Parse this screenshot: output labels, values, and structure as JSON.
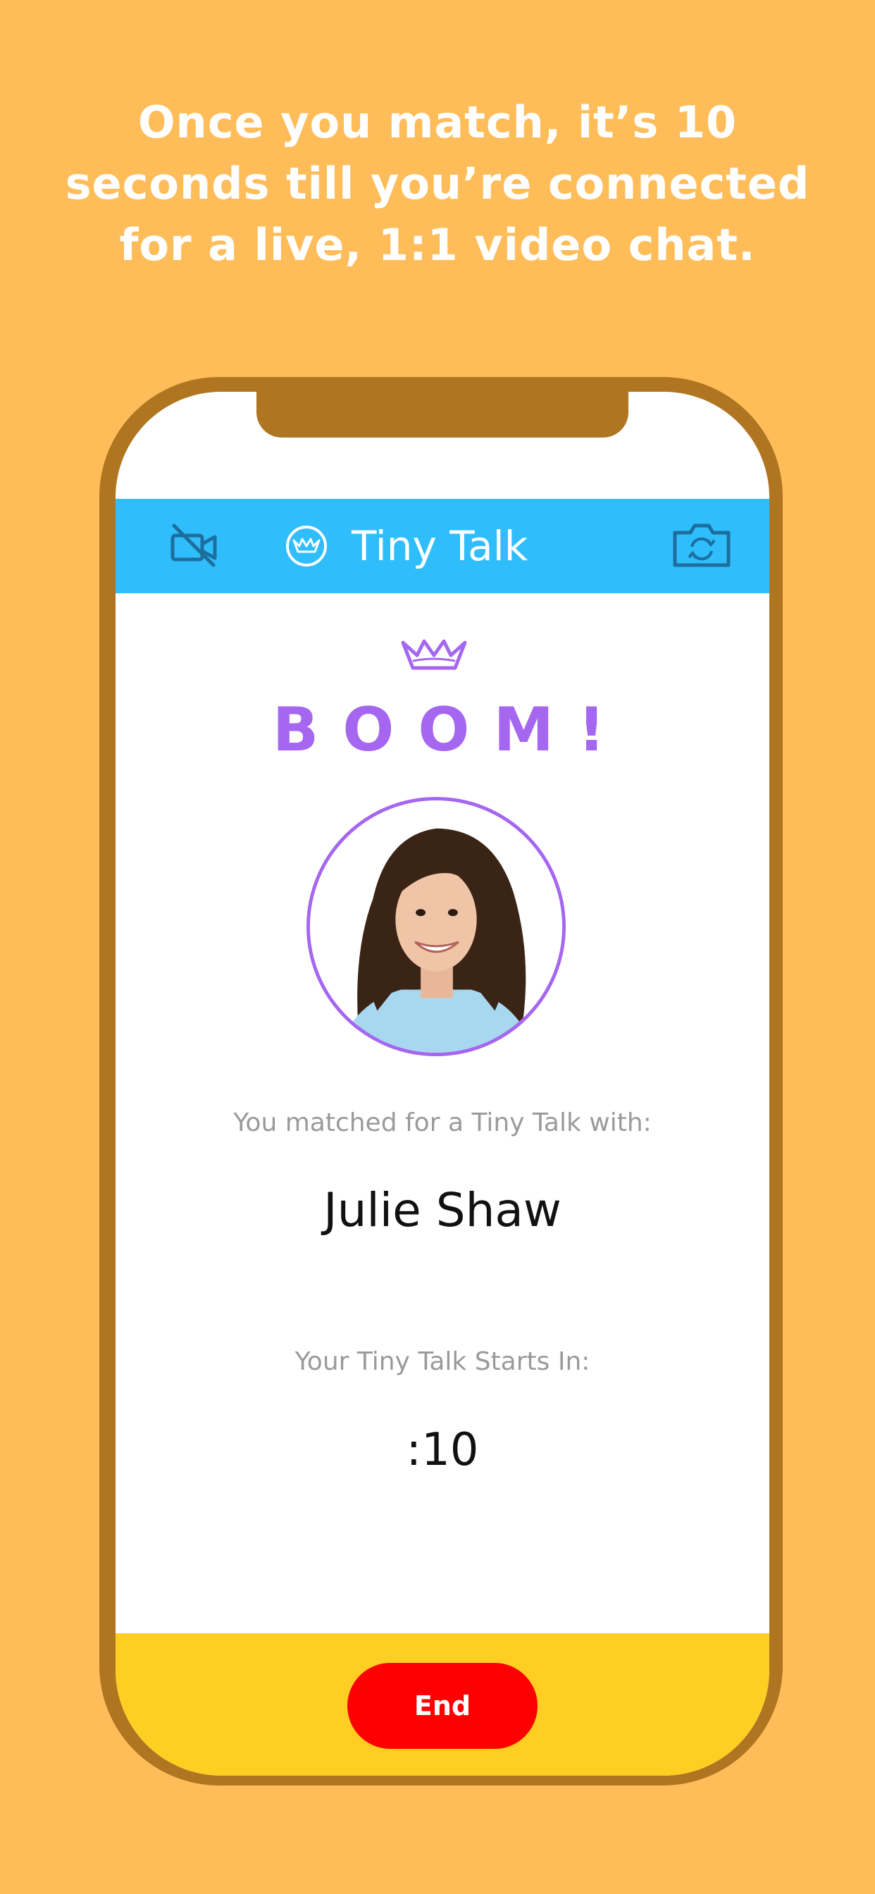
{
  "headline": {
    "lines": [
      "Once you match, it’s 10",
      "seconds till you’re connected",
      "for a live, 1:1 video chat."
    ]
  },
  "navbar": {
    "title": "Tiny Talk",
    "left_icon": "camera-off-icon",
    "right_icon": "switch-camera-icon",
    "logo_icon": "tiny-talk-logo-icon",
    "background": "#2FBDFB"
  },
  "match": {
    "heading": "BOOM!",
    "crown_icon": "crown-icon",
    "label": "You matched for a Tiny Talk with:",
    "name": "Julie Shaw",
    "starts_label": "Your Tiny Talk Starts In:",
    "countdown": ":10",
    "accent_color": "#A566F0"
  },
  "footer": {
    "end_label": "End",
    "end_color": "#FF0000",
    "bar_color": "#FFCE22"
  },
  "colors": {
    "page_background": "#FFBD5A",
    "phone_frame": "#B07520"
  }
}
